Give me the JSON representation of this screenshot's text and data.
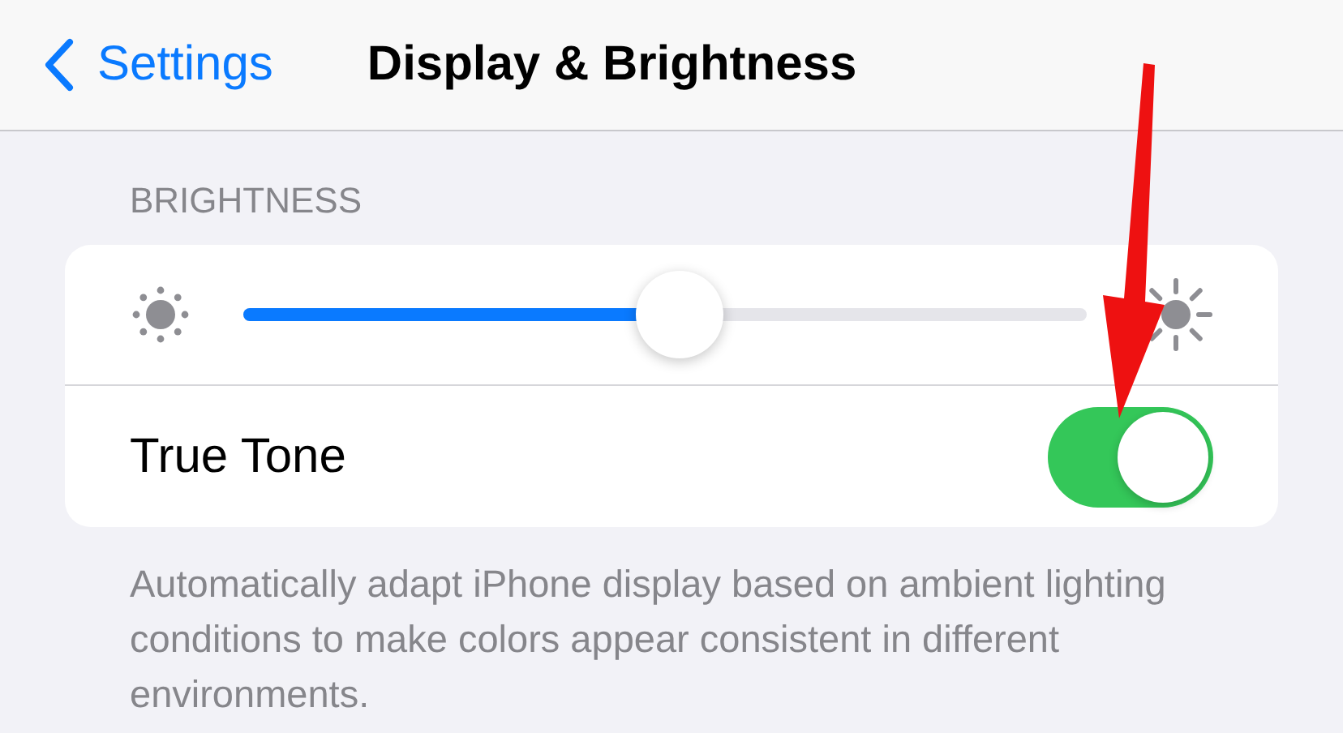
{
  "nav": {
    "back_label": "Settings",
    "title": "Display & Brightness"
  },
  "section": {
    "header": "BRIGHTNESS",
    "brightness": {
      "level": 0.517
    },
    "true_tone": {
      "label": "True Tone",
      "on": true
    },
    "footer": "Automatically adapt iPhone display based on ambient lighting conditions to make colors appear consistent in different environments."
  }
}
